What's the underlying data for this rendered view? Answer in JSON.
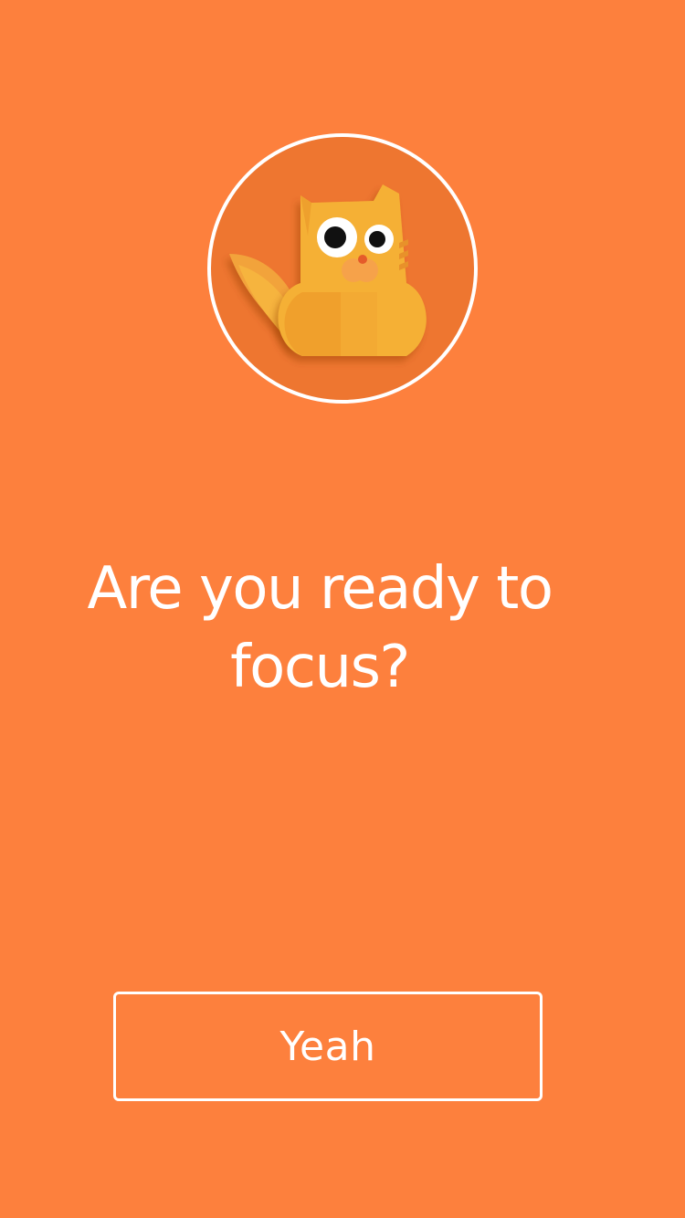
{
  "theme": {
    "background": "#FD803D",
    "avatar_background": "#EE7630",
    "text": "#FFFFFF",
    "cat_body": "#F5B034",
    "cat_shade": "#F09E2C"
  },
  "avatar": {
    "icon": "cat-mascot-icon"
  },
  "prompt": {
    "headline": "Are you ready to focus?"
  },
  "actions": {
    "confirm_label": "Yeah"
  }
}
